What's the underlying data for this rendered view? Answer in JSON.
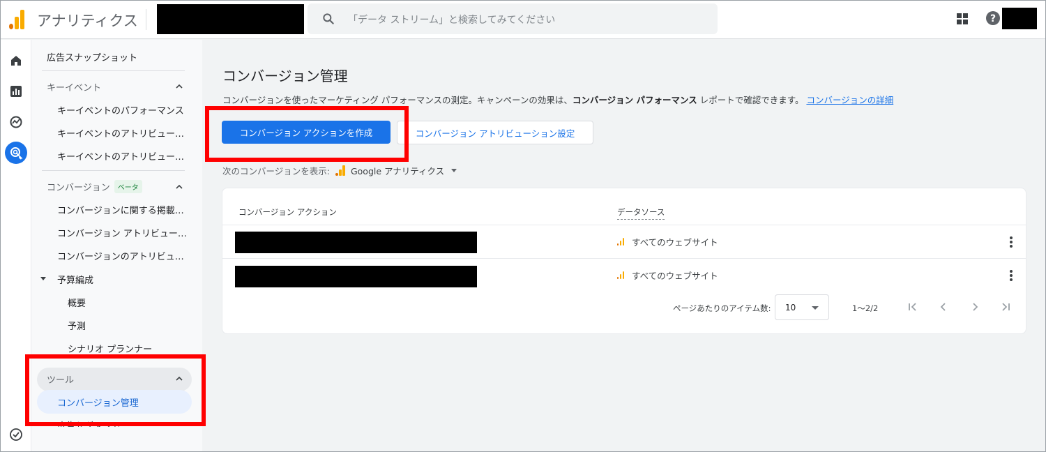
{
  "header": {
    "app_title": "アナリティクス",
    "search_placeholder": "「データ ストリーム」と検索してみてください"
  },
  "sidebar": {
    "ad_snapshot": "広告スナップショット",
    "key_events_section": "キーイベント",
    "key_events_items": [
      "キーイベントのパフォーマンス",
      "キーイベントのアトリビュー…",
      "キーイベントのアトリビュー…"
    ],
    "conversions_section": "コンバージョン",
    "conversions_badge": "ベータ",
    "conversions_items": [
      "コンバージョンに関する掲載…",
      "コンバージョン アトリビュー…",
      "コンバージョンのアトリビュ…"
    ],
    "budget_group": "予算編成",
    "budget_items": [
      "概要",
      "予測",
      "シナリオ プランナー"
    ],
    "tools_section": "ツール",
    "tools_active_item": "コンバージョン管理",
    "partial_item": "広告セグメント"
  },
  "main": {
    "title": "コンバージョン管理",
    "desc_prefix": "コンバージョンを使ったマーケティング パフォーマンスの測定。キャンペーンの効果は、",
    "desc_bold": "コンバージョン パフォーマンス",
    "desc_suffix": " レポートで確認できます。",
    "desc_link": "コンバージョンの詳細",
    "create_button": "コンバージョン アクションを作成",
    "attribution_button": "コンバージョン アトリビューション設定",
    "show_label": "次のコンバージョンを表示:",
    "show_value": "Google アナリティクス"
  },
  "table": {
    "col_action": "コンバージョン アクション",
    "col_source": "データソース",
    "rows": [
      {
        "source": "すべてのウェブサイト"
      },
      {
        "source": "すべてのウェブサイト"
      }
    ],
    "per_page_label": "ページあたりのアイテム数:",
    "per_page_value": "10",
    "range": "1〜2/2"
  },
  "colors": {
    "accent": "#1a73e8",
    "highlight": "#ff0000",
    "ga_orange": "#f9ab00",
    "ga_dark_orange": "#e37400"
  }
}
